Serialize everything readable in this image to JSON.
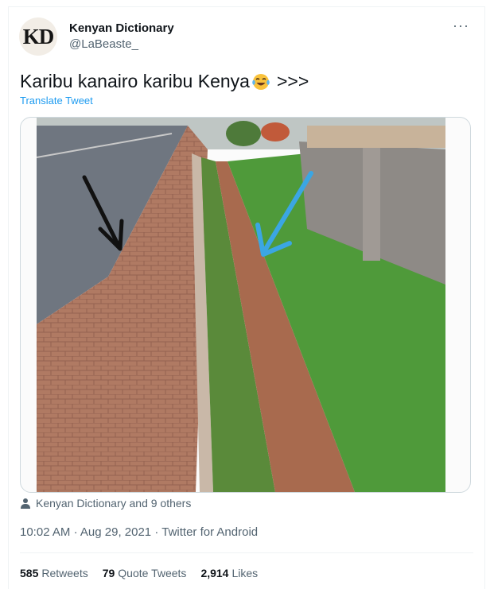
{
  "author": {
    "avatar_text": "KD",
    "name": "Kenyan Dictionary",
    "handle": "@LaBeaste_"
  },
  "more_icon": "more-icon",
  "tweet": {
    "text": "Karibu kanairo karibu Kenya",
    "emoji": "face-with-tears-of-joy",
    "suffix": ">>>",
    "translate_label": "Translate Tweet"
  },
  "social_context": {
    "icon": "person-icon",
    "text": "Kenyan Dictionary and 9 others"
  },
  "meta": {
    "time": "10:02 AM",
    "date": "Aug 29, 2021",
    "source": "Twitter for Android",
    "separator": "·"
  },
  "stats": {
    "retweets_count": "585",
    "retweets_label": "Retweets",
    "quotes_count": "79",
    "quotes_label": "Quote Tweets",
    "likes_count": "2,914",
    "likes_label": "Likes"
  },
  "colors": {
    "link": "#1d9bf0",
    "secondary": "#536471",
    "primary": "#0f1419"
  }
}
